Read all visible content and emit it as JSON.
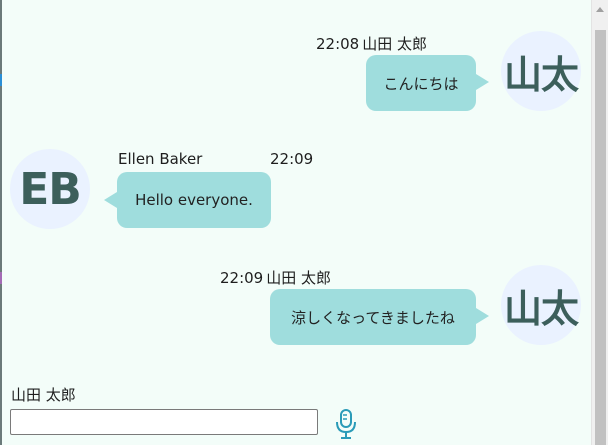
{
  "messages": [
    {
      "sender": "山田 太郎",
      "time": "22:08",
      "text": "こんにちは",
      "avatar_text": "山太",
      "side": "right"
    },
    {
      "sender": "Ellen Baker",
      "time": "22:09",
      "text": "Hello everyone.",
      "avatar_text": "EB",
      "side": "left"
    },
    {
      "sender": "山田 太郎",
      "time": "22:09",
      "text": "涼しくなってきましたね",
      "avatar_text": "山太",
      "side": "right"
    }
  ],
  "composer": {
    "user_name": "山田 太郎",
    "input_value": "",
    "input_placeholder": "",
    "mic_icon": "microphone-icon"
  },
  "colors": {
    "background": "#f3fdf9",
    "bubble": "#9fdddd",
    "avatar_bg": "#eaf2ff",
    "avatar_text": "#3c5f5b",
    "mic": "#2a9bb8"
  }
}
